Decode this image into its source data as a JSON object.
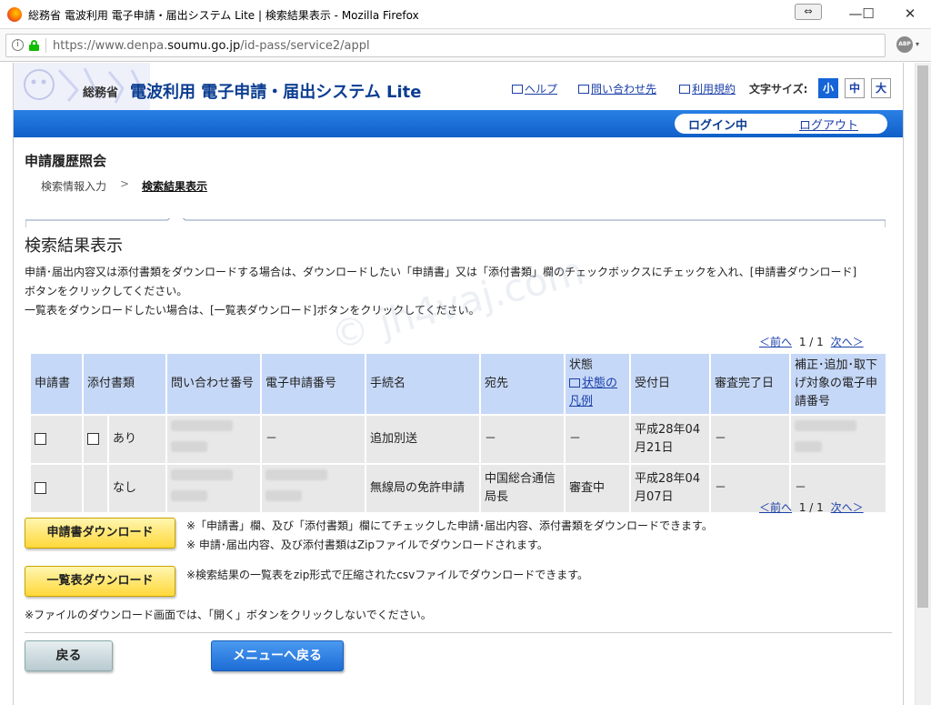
{
  "window": {
    "title": "総務省 電波利用 電子申請・届出システム Lite | 検索結果表示 - Mozilla Firefox",
    "restore_glyph": "⇔",
    "min_glyph": "—",
    "max_glyph": "☐",
    "close_glyph": "✕"
  },
  "browser": {
    "url_prefix": "https://www.denpa.",
    "url_domain": "soumu.go.jp",
    "url_suffix": "/id-pass/service2/appl",
    "info_glyph": "i",
    "adblock_label": "ABP",
    "adblock_caret": "▾"
  },
  "header": {
    "org": "総務省",
    "system_title": "電波利用 電子申請・届出システム Lite",
    "links": [
      "ヘルプ",
      "問い合わせ先",
      "利用規約"
    ],
    "font_size_label": "文字サイズ:",
    "font_sizes": [
      "小",
      "中",
      "大"
    ],
    "font_size_selected": "小",
    "login_status": "ログイン中",
    "logout": "ログアウト"
  },
  "page": {
    "heading": "申請履歴照会",
    "breadcrumb": [
      "検索情報入力",
      "検索結果表示"
    ],
    "breadcrumb_sep": ">",
    "section_title": "検索結果表示",
    "description": [
      "申請･届出内容又は添付書類をダウンロードする場合は、ダウンロードしたい「申請書」又は「添付書類」欄のチェックボックスにチェックを入れ、[申請書ダウンロード]",
      "ボタンをクリックしてください。",
      "一覧表をダウンロードしたい場合は、[一覧表ダウンロード]ボタンをクリックしてください。"
    ],
    "watermark": "© jh4vaj.com"
  },
  "pager": {
    "prev": "＜前へ",
    "position": "1 / 1",
    "next": "次へ＞"
  },
  "table": {
    "headers": [
      "申請書",
      "添付書類",
      "問い合わせ番号",
      "電子申請番号",
      "手続名",
      "宛先",
      "状態",
      "受付日",
      "審査完了日",
      "補正･追加･取下げ対象の電子申請番号"
    ],
    "status_header": "状態",
    "status_legend_link": "状態の凡例",
    "rows": [
      {
        "attachment": "あり",
        "e_app_no": "－",
        "procedure": "追加別送",
        "destination": "－",
        "status": "－",
        "received_date": "平成28年04月21日",
        "review_done": "－"
      },
      {
        "attachment": "なし",
        "procedure": "無線局の免許申請",
        "destination": "中国総合通信局長",
        "status": "審査中",
        "received_date": "平成28年04月07日",
        "review_done": "－",
        "amend_target": "－"
      }
    ]
  },
  "actions": {
    "download_app": "申請書ダウンロード",
    "download_app_notes": [
      "※「申請書」欄、及び「添付書類」欄にてチェックした申請･届出内容、添付書類をダウンロードできます。",
      "※ 申請･届出内容、及び添付書類はZipファイルでダウンロードされます。"
    ],
    "download_list": "一覧表ダウンロード",
    "download_list_note": "※検索結果の一覧表をzip形式で圧縮されたcsvファイルでダウンロードできます。",
    "footer_note": "※ファイルのダウンロード画面では、「開く」ボタンをクリックしないでください。",
    "back": "戻る",
    "menu_back": "メニューへ戻る"
  }
}
